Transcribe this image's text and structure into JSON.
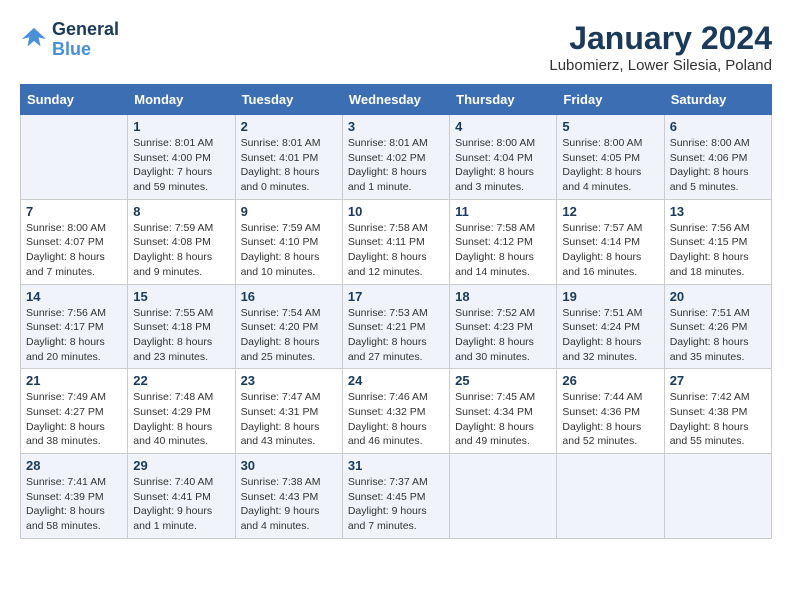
{
  "logo": {
    "line1": "General",
    "line2": "Blue"
  },
  "title": "January 2024",
  "subtitle": "Lubomierz, Lower Silesia, Poland",
  "weekdays": [
    "Sunday",
    "Monday",
    "Tuesday",
    "Wednesday",
    "Thursday",
    "Friday",
    "Saturday"
  ],
  "weeks": [
    [
      {
        "day": "",
        "info": ""
      },
      {
        "day": "1",
        "info": "Sunrise: 8:01 AM\nSunset: 4:00 PM\nDaylight: 7 hours and 59 minutes."
      },
      {
        "day": "2",
        "info": "Sunrise: 8:01 AM\nSunset: 4:01 PM\nDaylight: 8 hours and 0 minutes."
      },
      {
        "day": "3",
        "info": "Sunrise: 8:01 AM\nSunset: 4:02 PM\nDaylight: 8 hours and 1 minute."
      },
      {
        "day": "4",
        "info": "Sunrise: 8:00 AM\nSunset: 4:04 PM\nDaylight: 8 hours and 3 minutes."
      },
      {
        "day": "5",
        "info": "Sunrise: 8:00 AM\nSunset: 4:05 PM\nDaylight: 8 hours and 4 minutes."
      },
      {
        "day": "6",
        "info": "Sunrise: 8:00 AM\nSunset: 4:06 PM\nDaylight: 8 hours and 5 minutes."
      }
    ],
    [
      {
        "day": "7",
        "info": "Sunrise: 8:00 AM\nSunset: 4:07 PM\nDaylight: 8 hours and 7 minutes."
      },
      {
        "day": "8",
        "info": "Sunrise: 7:59 AM\nSunset: 4:08 PM\nDaylight: 8 hours and 9 minutes."
      },
      {
        "day": "9",
        "info": "Sunrise: 7:59 AM\nSunset: 4:10 PM\nDaylight: 8 hours and 10 minutes."
      },
      {
        "day": "10",
        "info": "Sunrise: 7:58 AM\nSunset: 4:11 PM\nDaylight: 8 hours and 12 minutes."
      },
      {
        "day": "11",
        "info": "Sunrise: 7:58 AM\nSunset: 4:12 PM\nDaylight: 8 hours and 14 minutes."
      },
      {
        "day": "12",
        "info": "Sunrise: 7:57 AM\nSunset: 4:14 PM\nDaylight: 8 hours and 16 minutes."
      },
      {
        "day": "13",
        "info": "Sunrise: 7:56 AM\nSunset: 4:15 PM\nDaylight: 8 hours and 18 minutes."
      }
    ],
    [
      {
        "day": "14",
        "info": "Sunrise: 7:56 AM\nSunset: 4:17 PM\nDaylight: 8 hours and 20 minutes."
      },
      {
        "day": "15",
        "info": "Sunrise: 7:55 AM\nSunset: 4:18 PM\nDaylight: 8 hours and 23 minutes."
      },
      {
        "day": "16",
        "info": "Sunrise: 7:54 AM\nSunset: 4:20 PM\nDaylight: 8 hours and 25 minutes."
      },
      {
        "day": "17",
        "info": "Sunrise: 7:53 AM\nSunset: 4:21 PM\nDaylight: 8 hours and 27 minutes."
      },
      {
        "day": "18",
        "info": "Sunrise: 7:52 AM\nSunset: 4:23 PM\nDaylight: 8 hours and 30 minutes."
      },
      {
        "day": "19",
        "info": "Sunrise: 7:51 AM\nSunset: 4:24 PM\nDaylight: 8 hours and 32 minutes."
      },
      {
        "day": "20",
        "info": "Sunrise: 7:51 AM\nSunset: 4:26 PM\nDaylight: 8 hours and 35 minutes."
      }
    ],
    [
      {
        "day": "21",
        "info": "Sunrise: 7:49 AM\nSunset: 4:27 PM\nDaylight: 8 hours and 38 minutes."
      },
      {
        "day": "22",
        "info": "Sunrise: 7:48 AM\nSunset: 4:29 PM\nDaylight: 8 hours and 40 minutes."
      },
      {
        "day": "23",
        "info": "Sunrise: 7:47 AM\nSunset: 4:31 PM\nDaylight: 8 hours and 43 minutes."
      },
      {
        "day": "24",
        "info": "Sunrise: 7:46 AM\nSunset: 4:32 PM\nDaylight: 8 hours and 46 minutes."
      },
      {
        "day": "25",
        "info": "Sunrise: 7:45 AM\nSunset: 4:34 PM\nDaylight: 8 hours and 49 minutes."
      },
      {
        "day": "26",
        "info": "Sunrise: 7:44 AM\nSunset: 4:36 PM\nDaylight: 8 hours and 52 minutes."
      },
      {
        "day": "27",
        "info": "Sunrise: 7:42 AM\nSunset: 4:38 PM\nDaylight: 8 hours and 55 minutes."
      }
    ],
    [
      {
        "day": "28",
        "info": "Sunrise: 7:41 AM\nSunset: 4:39 PM\nDaylight: 8 hours and 58 minutes."
      },
      {
        "day": "29",
        "info": "Sunrise: 7:40 AM\nSunset: 4:41 PM\nDaylight: 9 hours and 1 minute."
      },
      {
        "day": "30",
        "info": "Sunrise: 7:38 AM\nSunset: 4:43 PM\nDaylight: 9 hours and 4 minutes."
      },
      {
        "day": "31",
        "info": "Sunrise: 7:37 AM\nSunset: 4:45 PM\nDaylight: 9 hours and 7 minutes."
      },
      {
        "day": "",
        "info": ""
      },
      {
        "day": "",
        "info": ""
      },
      {
        "day": "",
        "info": ""
      }
    ]
  ]
}
